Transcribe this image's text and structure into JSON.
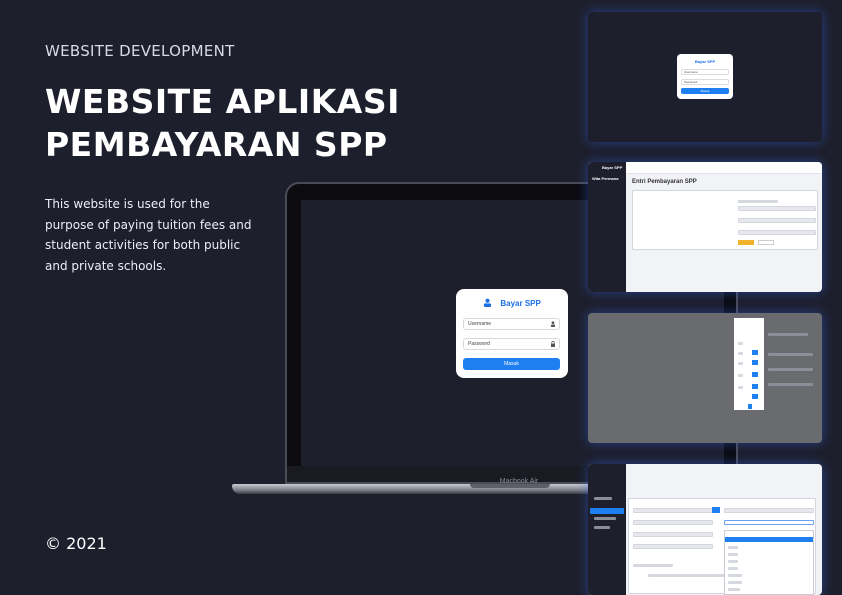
{
  "eyebrow": "WEBSITE DEVELOPMENT",
  "title_line1": "WEBSITE APLIKASI",
  "title_line2": "PEMBAYARAN SPP",
  "description": "This website is used for the purpose of paying tuition fees and student activities for both public and private schools.",
  "copyright": "© 2021",
  "laptop": {
    "brand": "Macbook Air",
    "login": {
      "app_name": "Bayar SPP",
      "username_placeholder": "Username",
      "password_placeholder": "Password",
      "submit_label": "Masuk"
    }
  },
  "thumbnails": {
    "login": {
      "app_name": "Bayar SPP",
      "username": "Username",
      "password": "Password",
      "submit": "Masuk"
    },
    "entry": {
      "app_name": "Bayar SPP",
      "heading": "Entri Pembayaran SPP",
      "user": "Wita Permana"
    }
  },
  "colors": {
    "background": "#1e1f2c",
    "accent": "#1e7ff0",
    "glow": "#326eff"
  }
}
